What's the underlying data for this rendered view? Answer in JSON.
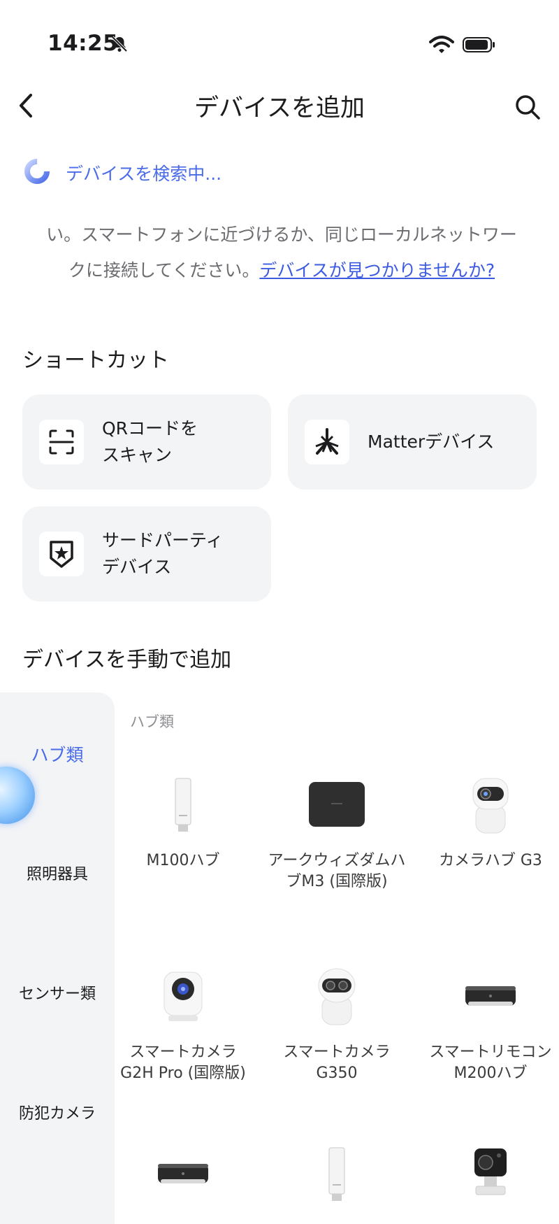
{
  "status": {
    "time": "14:25"
  },
  "nav": {
    "title": "デバイスを追加"
  },
  "search_status": {
    "text": "デバイスを検索中..."
  },
  "hint": {
    "text": "い。スマートフォンに近づけるか、同じローカルネットワークに接続してください。",
    "link": "デバイスが見つかりませんか?"
  },
  "shortcuts": {
    "title": "ショートカット",
    "items": [
      {
        "label": "QRコードを\nスキャン",
        "icon": "qr-scan-icon"
      },
      {
        "label": "Matterデバイス",
        "icon": "matter-icon"
      },
      {
        "label": "サードパーティ\nデバイス",
        "icon": "shield-star-icon"
      }
    ]
  },
  "manual": {
    "title": "デバイスを手動で追加",
    "categories": [
      {
        "label": "ハブ類",
        "active": true
      },
      {
        "label": "照明器具",
        "active": false
      },
      {
        "label": "センサー類",
        "active": false
      },
      {
        "label": "防犯カメラ",
        "active": false
      }
    ],
    "subcategory": "ハブ類",
    "devices": [
      {
        "name": "M100ハブ",
        "icon": "usb-hub-icon"
      },
      {
        "name": "アークウィズダムハブM3 (国際版)",
        "icon": "black-hub-icon"
      },
      {
        "name": "カメラハブ G3",
        "icon": "camera-hub-icon"
      },
      {
        "name": "スマートカメラG2H Pro (国際版)",
        "icon": "cube-camera-icon"
      },
      {
        "name": "スマートカメラG350",
        "icon": "ptz-camera-icon"
      },
      {
        "name": "スマートリモコンM200ハブ",
        "icon": "remote-hub-icon"
      },
      {
        "name": "",
        "icon": "remote-hub-icon"
      },
      {
        "name": "",
        "icon": "usb-hub-icon"
      },
      {
        "name": "",
        "icon": "outdoor-camera-icon"
      }
    ]
  },
  "colors": {
    "accent": "#4A6CE8",
    "card_bg": "#f3f4f6",
    "link": "#3D5BE0"
  }
}
